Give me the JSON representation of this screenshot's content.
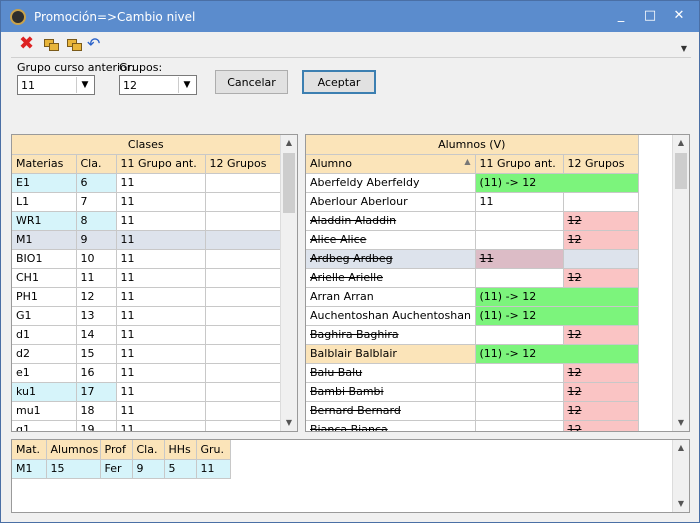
{
  "window": {
    "title": "Promoción=>Cambio nivel",
    "minimize": "_",
    "maximize": "□",
    "close": "✕"
  },
  "toolbar": {
    "delete_icon": "red-x-icon",
    "copy_icon": "copy-icon",
    "paste_icon": "paste-icon",
    "undo_icon": "undo-icon"
  },
  "params": {
    "prev_group_label": "Grupo curso anterior:",
    "prev_group_value": "11",
    "groups_label": "Grupos:",
    "groups_value": "12",
    "cancel_label": "Cancelar",
    "accept_label": "Aceptar"
  },
  "classes": {
    "band": "Clases",
    "columns": [
      "Materias",
      "Cla.",
      "11 Grupo ant.",
      "12 Grupos"
    ],
    "rows": [
      [
        "E1",
        "6",
        "11",
        ""
      ],
      [
        "L1",
        "7",
        "11",
        ""
      ],
      [
        "WR1",
        "8",
        "11",
        ""
      ],
      [
        "M1",
        "9",
        "11",
        ""
      ],
      [
        "BIO1",
        "10",
        "11",
        ""
      ],
      [
        "CH1",
        "11",
        "11",
        ""
      ],
      [
        "PH1",
        "12",
        "11",
        ""
      ],
      [
        "G1",
        "13",
        "11",
        ""
      ],
      [
        "d1",
        "14",
        "11",
        ""
      ],
      [
        "d2",
        "15",
        "11",
        ""
      ],
      [
        "e1",
        "16",
        "11",
        ""
      ],
      [
        "ku1",
        "17",
        "11",
        ""
      ],
      [
        "mu1",
        "18",
        "11",
        ""
      ],
      [
        "g1",
        "19",
        "11",
        ""
      ]
    ]
  },
  "students": {
    "band": "Alumnos (V)",
    "columns": [
      "Alumno",
      "11 Grupo ant.",
      "12 Grupos"
    ],
    "rows": [
      [
        "Aberfeldy Aberfeldy",
        "(11)  ->  12",
        ""
      ],
      [
        "Aberlour Aberlour",
        "11",
        ""
      ],
      [
        "Aladdin Aladdin",
        "",
        "12"
      ],
      [
        "Alice Alice",
        "",
        "12"
      ],
      [
        "Ardbeg Ardbeg",
        "11",
        ""
      ],
      [
        "Arielle Arielle",
        "",
        "12"
      ],
      [
        "Arran Arran",
        "(11)  ->  12",
        ""
      ],
      [
        "Auchentoshan Auchentoshan",
        "(11)  ->  12",
        ""
      ],
      [
        "Baghira Baghira",
        "",
        "12"
      ],
      [
        "Balblair Balblair",
        "(11)  ->  12",
        ""
      ],
      [
        "Balu Balu",
        "",
        "12"
      ],
      [
        "Bambi Bambi",
        "",
        "12"
      ],
      [
        "Bernard Bernard",
        "",
        "12"
      ],
      [
        "Bianca Bianca",
        "",
        "12"
      ]
    ]
  },
  "summary": {
    "columns": [
      "Mat.",
      "Alumnos",
      "Prof",
      "Cla.",
      "HHs",
      "Gru."
    ],
    "row": [
      "M1",
      "15",
      "Fer",
      "9",
      "5",
      "11"
    ]
  },
  "colors": {
    "title_bar": "#5b8ccd",
    "header": "#fbe4b9",
    "cyan": "#d6f4fa",
    "green": "#7cf47c",
    "pink": "#fac4c4"
  }
}
